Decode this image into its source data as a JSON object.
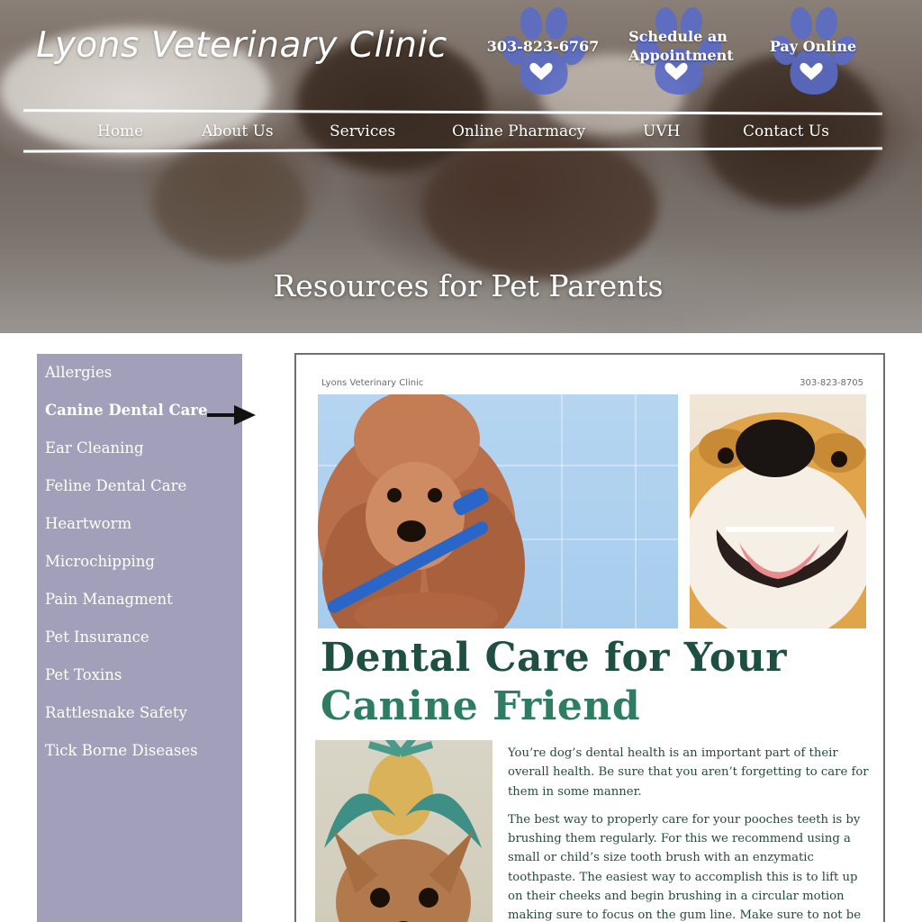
{
  "header": {
    "site_title": "Lyons Veterinary Clinic",
    "phone": "303-823-6767",
    "schedule_label": "Schedule an Appointment",
    "pay_label": "Pay Online",
    "paw_color": "#5b6bc8"
  },
  "nav": {
    "items": [
      "Home",
      "About Us",
      "Services",
      "Online Pharmacy",
      "UVH",
      "Contact Us"
    ]
  },
  "hero": {
    "heading": "Resources for Pet Parents"
  },
  "sidebar": {
    "background": "#a19fb9",
    "items": [
      "Allergies",
      "Canine Dental Care",
      "Ear Cleaning",
      "Feline Dental Care",
      "Heartworm",
      "Microchipping",
      "Pain Managment",
      "Pet Insurance",
      "Pet Toxins",
      "Rattlesnake Safety",
      "Tick Borne Diseases"
    ],
    "active": "Canine Dental Care"
  },
  "flyer": {
    "clinic": "Lyons Veterinary Clinic",
    "phone": "303-823-8705",
    "title_line1": "Dental Care for Your",
    "title_line2": "Canine Friend",
    "paragraphs": [
      "You’re dog’s dental health is an important part of their overall health. Be sure that you aren’t forgetting to care for them in some manner.",
      "The best way to properly care for your pooches teeth is by brushing them regularly. For this we recommend using a small or child’s size tooth brush with an enzymatic toothpaste. The easiest way to accomplish this is to lift up on their cheeks and begin brushing in a circular motion making sure to focus on the gum line. Make sure to not be rough, we don’t want to hurt your pal."
    ],
    "title_colors": [
      "#1f4f43",
      "#2e7d63"
    ]
  }
}
